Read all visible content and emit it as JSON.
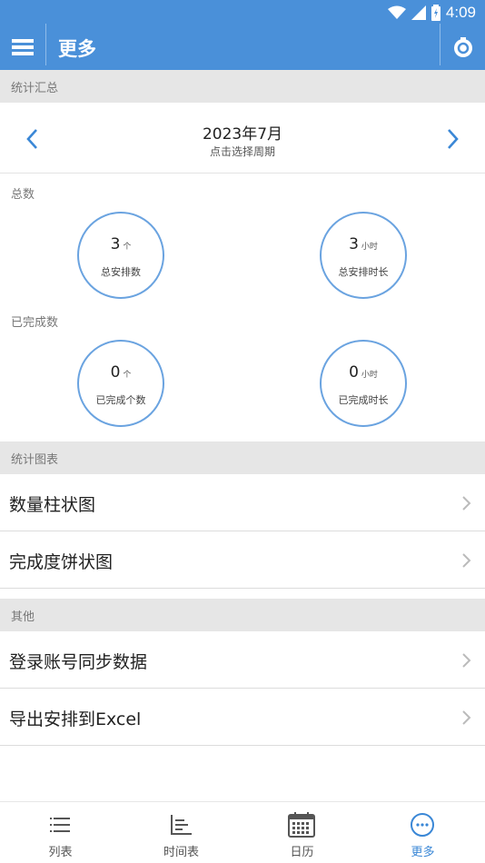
{
  "status_bar": {
    "time": "4:09"
  },
  "header": {
    "title": "更多"
  },
  "sections": {
    "summary": "统计汇总",
    "charts": "统计图表",
    "other": "其他"
  },
  "period": {
    "month": "2023年7月",
    "hint": "点击选择周期"
  },
  "totals": {
    "label": "总数",
    "items": [
      {
        "value": "3",
        "unit": "个",
        "caption": "总安排数"
      },
      {
        "value": "3",
        "unit": "小时",
        "caption": "总安排时长"
      }
    ]
  },
  "completed": {
    "label": "已完成数",
    "items": [
      {
        "value": "0",
        "unit": "个",
        "caption": "已完成个数"
      },
      {
        "value": "0",
        "unit": "小时",
        "caption": "已完成时长"
      }
    ]
  },
  "chart_items": [
    "数量柱状图",
    "完成度饼状图"
  ],
  "other_items": [
    "登录账号同步数据",
    "导出安排到Excel"
  ],
  "bottom_nav": {
    "tabs": [
      {
        "label": "列表",
        "icon": "list-icon",
        "active": false
      },
      {
        "label": "时间表",
        "icon": "timeline-icon",
        "active": false
      },
      {
        "label": "日历",
        "icon": "calendar-icon",
        "active": false
      },
      {
        "label": "更多",
        "icon": "more-icon",
        "active": true
      }
    ]
  },
  "colors": {
    "primary": "#4a90d9",
    "accent": "#3a87d6",
    "circle_border": "#6aa3e0"
  }
}
